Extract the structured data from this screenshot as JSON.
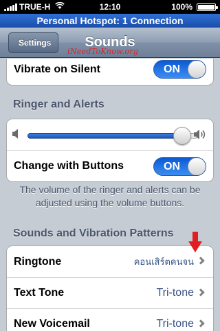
{
  "status_bar": {
    "carrier": "TRUE-H",
    "time": "12:10",
    "battery": "100%"
  },
  "hotspot_banner": "Personal Hotspot: 1 Connection",
  "nav": {
    "back_label": "Settings",
    "title": "Sounds",
    "watermark": "iNeedToKnow.org"
  },
  "vibrate_group": {
    "label": "Vibrate on Silent",
    "switch_state": "ON"
  },
  "ringer_section": {
    "header": "Ringer and Alerts",
    "volume_level": 0.91,
    "change_with_buttons_label": "Change with Buttons",
    "change_with_buttons_state": "ON",
    "footer_line1": "The volume of the ringer and alerts can be",
    "footer_line2": "adjusted using the volume buttons."
  },
  "patterns_section": {
    "header": "Sounds and Vibration Patterns",
    "rows": [
      {
        "label": "Ringtone",
        "value": "คอนเสิร์ตคนจน"
      },
      {
        "label": "Text Tone",
        "value": "Tri-tone"
      },
      {
        "label": "New Voicemail",
        "value": "Tri-tone"
      }
    ]
  },
  "colors": {
    "switch_on": "#1e6fe6",
    "value_text": "#385487",
    "annotation_arrow": "#e02020"
  },
  "icons": [
    "wifi-icon",
    "battery-icon",
    "speaker-low-icon",
    "speaker-high-icon",
    "chevron-right-icon",
    "red-arrow-icon"
  ]
}
